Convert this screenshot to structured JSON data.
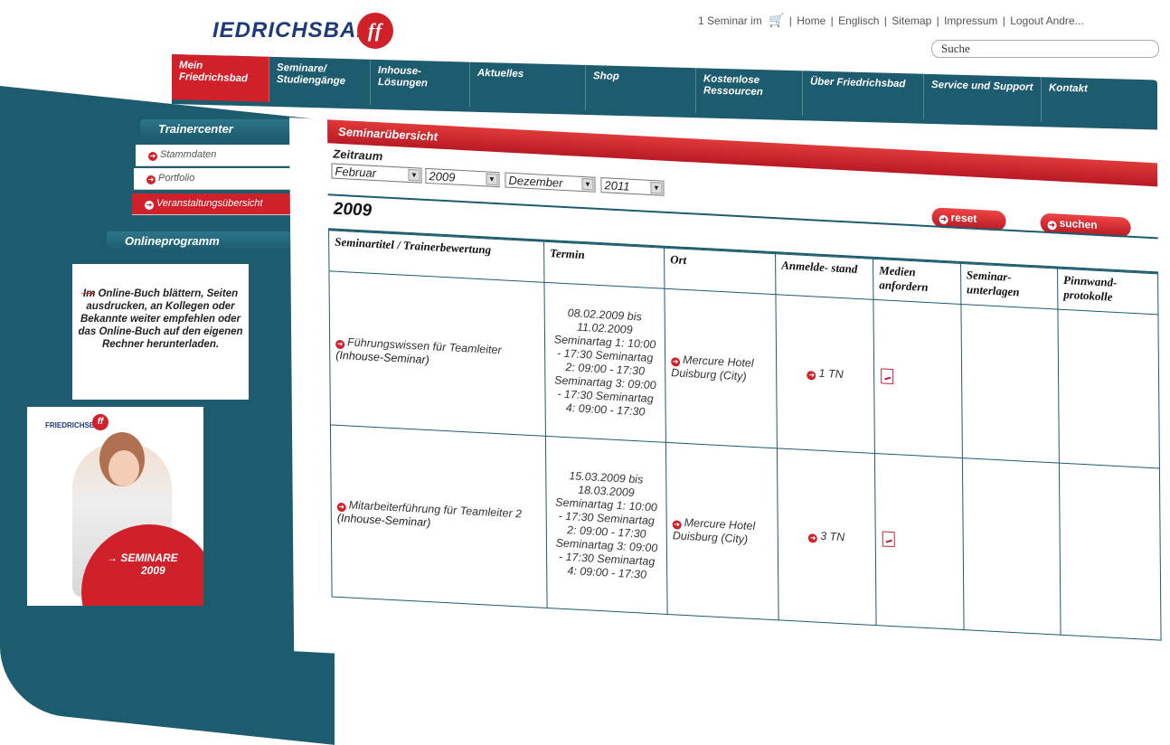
{
  "logo": {
    "text": "IEDRICHSBAD",
    "mark": "ff"
  },
  "toplinks": {
    "cart_text": "1 Seminar im",
    "links": [
      "Home",
      "Englisch",
      "Sitemap",
      "Impressum",
      "Logout Andre..."
    ]
  },
  "search": {
    "placeholder": "Suche"
  },
  "nav": {
    "items": [
      "Mein Friedrichsbad",
      "Seminare/ Studiengänge",
      "Inhouse- Lösungen",
      "Aktuelles",
      "Shop",
      "Kostenlose Ressourcen",
      "Über Friedrichsbad",
      "Service und Support",
      "Kontakt"
    ],
    "active_index": 0
  },
  "sidebar": {
    "trainercenter_title": "Trainercenter",
    "items": [
      "Stammdaten",
      "Portfolio",
      "Veranstaltungsübersicht"
    ],
    "active_index": 2,
    "online_title": "Onlineprogramm",
    "promo_text": "Im Online-Buch blättern, Seiten ausdrucken, an Kollegen oder Bekannte weiter empfehlen oder das Online-Buch auf den eigenen Rechner herunterladen.",
    "image_logo": "FRIEDRICHSBAD",
    "image_mark": "ff",
    "image_label_1": "→ SEMINARE",
    "image_label_2": "2009"
  },
  "main": {
    "section_title": "Seminarübersicht",
    "zeitraum_label": "Zeitraum",
    "from_month": "Februar",
    "from_year": "2009",
    "to_month": "Dezember",
    "to_year": "2011",
    "reset_label": "reset",
    "search_label": "suchen",
    "year_heading": "2009",
    "columns": [
      "Seminartitel / Trainerbewertung",
      "Termin",
      "Ort",
      "Anmelde- stand",
      "Medien anfordern",
      "Seminar- unterlagen",
      "Pinnwand- protokolle"
    ],
    "rows": [
      {
        "title": "Führungswissen für Teamleiter",
        "note": "(Inhouse-Seminar)",
        "termin": "08.02.2009 bis 11.02.2009 Seminartag 1: 10:00 - 17:30 Seminartag 2: 09:00 - 17:30 Seminartag 3: 09:00 - 17:30 Seminartag 4: 09:00 - 17:30",
        "ort": "Mercure Hotel Duisburg (City)",
        "anmeldestand": "1 TN"
      },
      {
        "title": "Mitarbeiterführung für Teamleiter 2",
        "note": "(Inhouse-Seminar)",
        "termin": "15.03.2009 bis 18.03.2009 Seminartag 1: 10:00 - 17:30 Seminartag 2: 09:00 - 17:30 Seminartag 3: 09:00 - 17:30 Seminartag 4: 09:00 - 17:30",
        "ort": "Mercure Hotel Duisburg (City)",
        "anmeldestand": "3 TN"
      }
    ]
  },
  "colors": {
    "brand_teal": "#1d5b6e",
    "brand_red": "#d0202a"
  }
}
